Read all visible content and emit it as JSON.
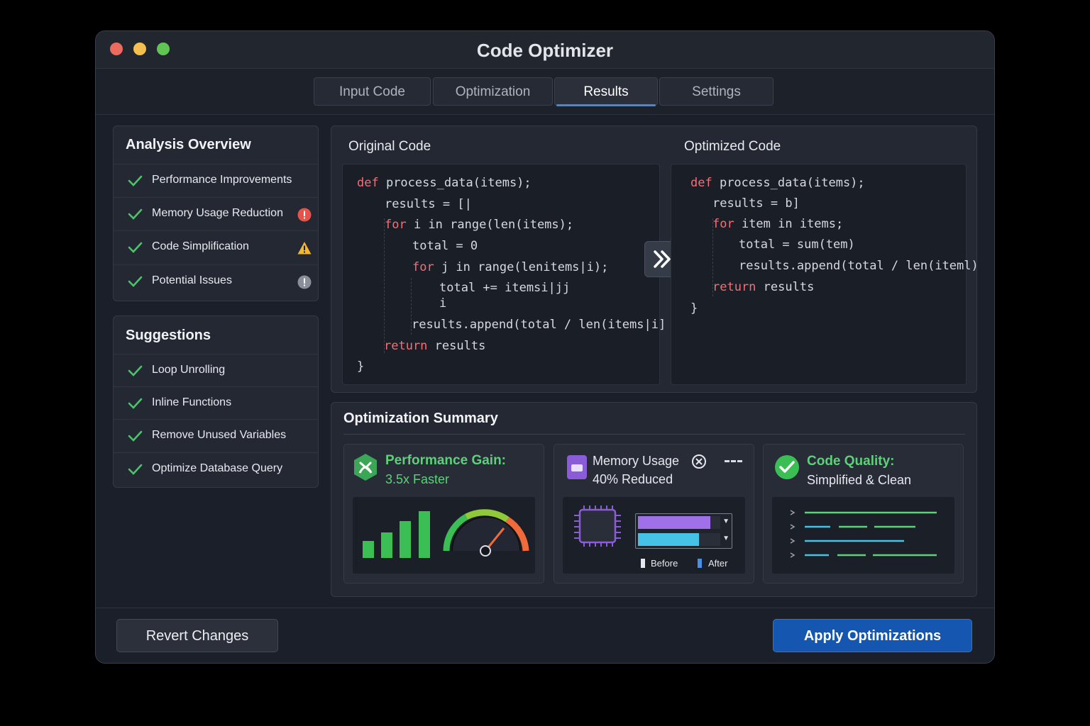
{
  "window": {
    "title": "Code Optimizer"
  },
  "tabs": [
    {
      "label": "Input Code",
      "active": false
    },
    {
      "label": "Optimization",
      "active": false
    },
    {
      "label": "Results",
      "active": true
    },
    {
      "label": "Settings",
      "active": false
    }
  ],
  "analysis": {
    "title": "Analysis Overview",
    "items": [
      {
        "label": "Performance Improvements",
        "badge": ""
      },
      {
        "label": "Memory Usage Reduction",
        "badge": "alert-circle-icon"
      },
      {
        "label": "Code Simplification",
        "badge": "warning-triangle-icon"
      },
      {
        "label": "Potential Issues",
        "badge": "info-circle-icon"
      }
    ]
  },
  "suggestions": {
    "title": "Suggestions",
    "items": [
      {
        "label": "Loop Unrolling"
      },
      {
        "label": "Inline Functions"
      },
      {
        "label": "Remove Unused Variables"
      },
      {
        "label": "Optimize Database Query"
      }
    ]
  },
  "code": {
    "original_label": "Original Code",
    "optimized_label": "Optimized Code",
    "original": [
      {
        "kw": "def",
        "text": " process_data(items);"
      },
      {
        "kw": "",
        "text": "results = [|"
      },
      {
        "kw": "for",
        "text": " i in range(len(items);"
      },
      {
        "kw": "",
        "text": "total = 0"
      },
      {
        "kw": "for",
        "text": " j in range(lenitems|i);"
      },
      {
        "kw": "",
        "text": "total += itemsi|jj"
      },
      {
        "kw": "",
        "text": "i"
      },
      {
        "kw": "",
        "text": "results.append(total / len(items|i]"
      },
      {
        "kw": "return",
        "text": " results"
      },
      {
        "kw": "",
        "text": "}"
      }
    ],
    "optimized": [
      {
        "kw": "def",
        "text": " process_data(items);"
      },
      {
        "kw": "",
        "text": "results = b]"
      },
      {
        "kw": "for",
        "text": " item in items;"
      },
      {
        "kw": "",
        "text": "total = sum(tem)"
      },
      {
        "kw": "",
        "text": "results.append(total / len(iteml)"
      },
      {
        "kw": "return",
        "text": " results"
      },
      {
        "kw": "",
        "text": "}"
      }
    ]
  },
  "summary": {
    "title": "Optimization Summary",
    "performance": {
      "title": "Performance Gain:",
      "value": "3.5x Faster"
    },
    "memory": {
      "title": "Memory Usage",
      "value": "40% Reduced",
      "legend_before": "Before",
      "legend_after": "After",
      "before_fraction": 0.88,
      "after_fraction": 0.74
    },
    "quality": {
      "title": "Code Quality:",
      "value": "Simplified & Clean"
    }
  },
  "buttons": {
    "revert": "Revert Changes",
    "apply": "Apply Optimizations"
  },
  "colors": {
    "accent": "#3b8ae6",
    "apply_bg": "#1557b0",
    "green": "#4cc36b",
    "keyword": "#f07178",
    "memory_before": "#a070e8",
    "memory_after": "#45c2e6"
  }
}
